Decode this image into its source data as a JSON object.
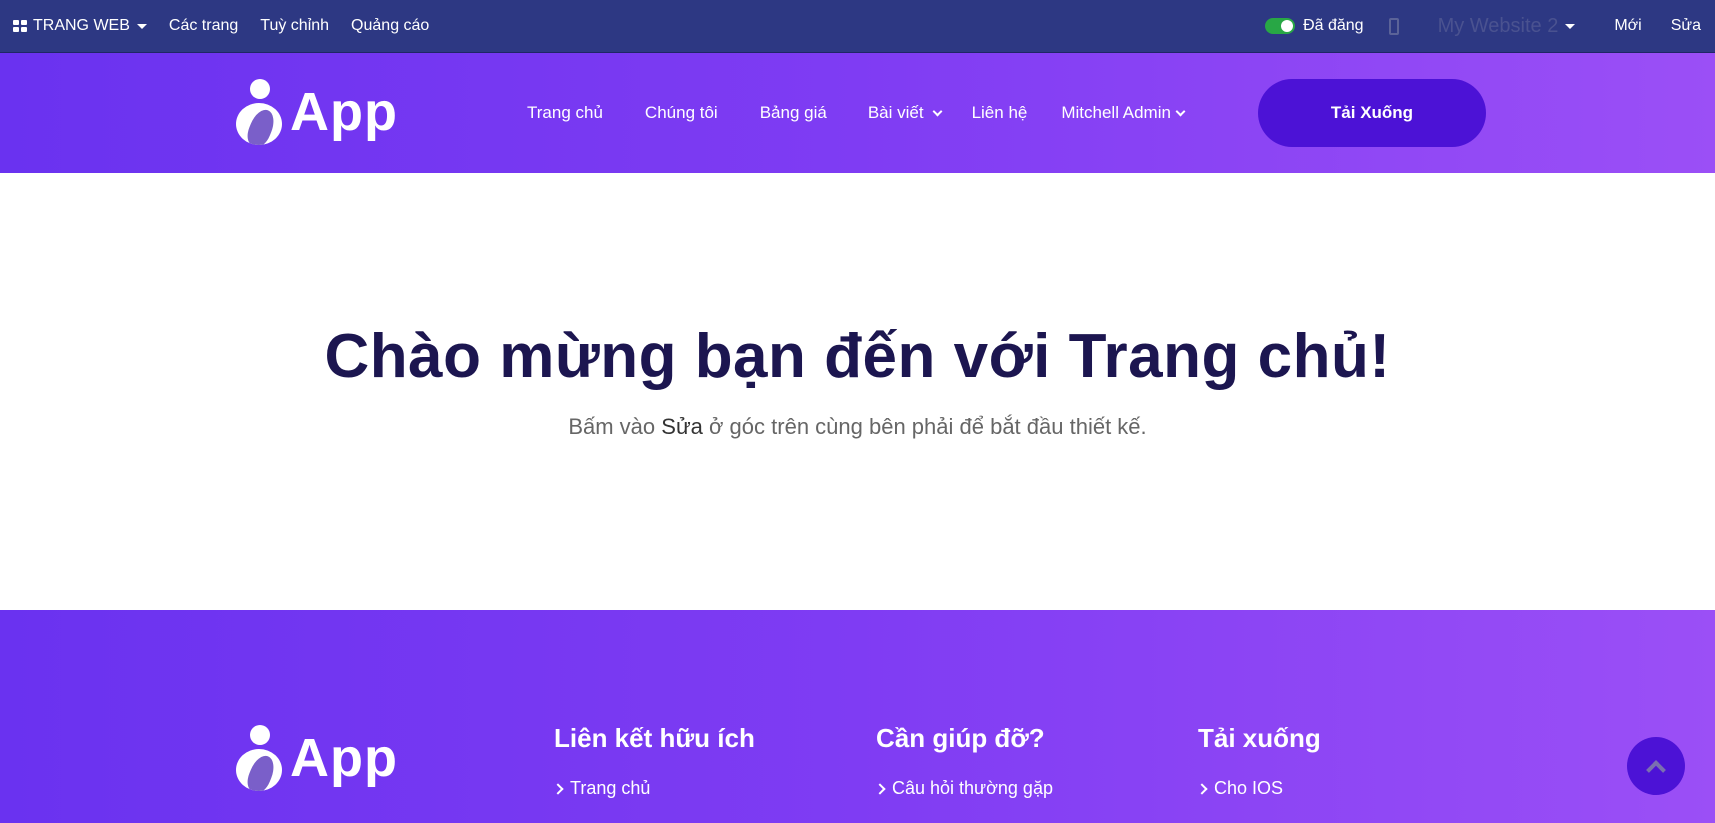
{
  "adminbar": {
    "website_menu": "TRANG WEB",
    "pages": "Các trang",
    "customize": "Tuỳ chỉnh",
    "promote": "Quảng cáo",
    "published": "Đã đăng",
    "site_name": "My Website 2",
    "new": "Mới",
    "edit": "Sửa"
  },
  "header": {
    "logo_text": "App",
    "nav": {
      "home": "Trang chủ",
      "about": "Chúng tôi",
      "pricing": "Bảng giá",
      "blog": "Bài viết",
      "contact": "Liên hệ",
      "user": "Mitchell Admin"
    },
    "download_button": "Tải Xuống"
  },
  "hero": {
    "title": "Chào mừng bạn đến với Trang chủ!",
    "subtitle_before": "Bấm vào ",
    "subtitle_bold": "Sửa",
    "subtitle_after": " ở góc trên cùng bên phải để bắt đầu thiết kế."
  },
  "footer": {
    "logo_text": "App",
    "columns": [
      {
        "title": "Liên kết hữu ích",
        "first_link": "Trang chủ"
      },
      {
        "title": "Cần giúp đỡ?",
        "first_link": "Câu hỏi thường gặp"
      },
      {
        "title": "Tải xuống",
        "first_link": "Cho IOS"
      }
    ]
  },
  "colors": {
    "adminbar": "#2d3883",
    "brand_purple": "#7f3cf3",
    "button": "#4c12d6",
    "heading": "#1c1650",
    "toggle_on": "#28a745"
  },
  "icons": [
    "grid-icon",
    "caret-down-icon",
    "toggle-switch",
    "mobile-preview-icon",
    "chevron-down-icon",
    "chevron-right-icon",
    "arrow-up-icon"
  ]
}
